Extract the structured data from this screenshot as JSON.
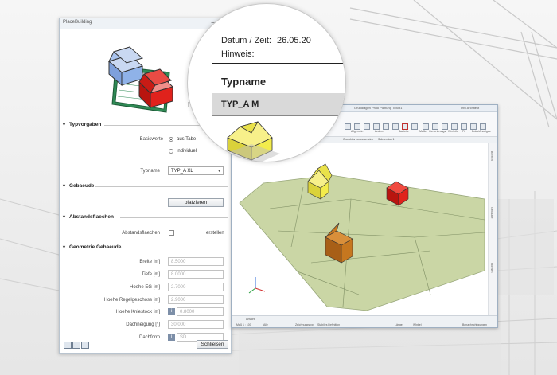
{
  "panel": {
    "title": "PlaceBuilding",
    "cut_text": "metsch",
    "sections": {
      "typvorgaben": "Typvorgaben",
      "gebaeude": "Gebaeude",
      "abstandsflaechen": "Abstandsflaechen",
      "geometrie": "Geometrie Gebaeude"
    },
    "basiswerte_label": "Basiswerte",
    "basiswerte_options": [
      "aus Tabe",
      "individuell"
    ],
    "typname_label": "Typname",
    "typname_value": "TYP_A XL",
    "place_button": "platzieren",
    "abstand_label": "Abstandsflaechen",
    "abstand_option": "erstellen",
    "geometry_fields": [
      {
        "label": "Breite [m]",
        "value": "8.5000"
      },
      {
        "label": "Tiefe [m]",
        "value": "8.0000"
      },
      {
        "label": "Hoehe EG [m]",
        "value": "2.7000"
      },
      {
        "label": "Hoehe Regelgeschoss [m]",
        "value": "2.9000"
      },
      {
        "label": "Hoehe Kniestock [m]",
        "value": "0.8000"
      },
      {
        "label": "Dachneigung [°]",
        "value": "30.000"
      },
      {
        "label": "Dachform",
        "value": "SD"
      }
    ],
    "close_button": "Schließen"
  },
  "magnifier": {
    "date_label": "Datum / Zeit:",
    "date_value": "26.05.20",
    "hint_label": "Hinweis:",
    "typname_header": "Typname",
    "typname_value": "TYP_A M"
  },
  "cad": {
    "title": "Grundlagen Proki Planung TM091",
    "user": "Info Architekt",
    "ribbon_labels": [
      "Allgemein",
      "Ändern",
      "Bauteile",
      "Maße",
      "Generierungs",
      "Wertbild",
      "Fit",
      "Doku/Anzeiges"
    ],
    "view_tabs": [
      "Grundriss vor cenerfeine",
      "Subversion 1"
    ],
    "side_labels": [
      "Bereich",
      "Gebäude",
      "Normen"
    ],
    "status": {
      "zoom": "1:1",
      "scale": "Maß 1 : 100",
      "unit": "Alle",
      "drawing": "Zeichnungstyp",
      "definition": "Stabiles Definition",
      "length": "Länge",
      "angle": "Winkel",
      "notes": "Benachrichtigungen",
      "view": "Ansicht"
    }
  },
  "colors": {
    "ground": "#cad6a5",
    "house_yellow": "#f3ec4c",
    "house_red": "#e0221c",
    "house_blue": "#8fb2e8",
    "house_brown": "#c6771f"
  }
}
